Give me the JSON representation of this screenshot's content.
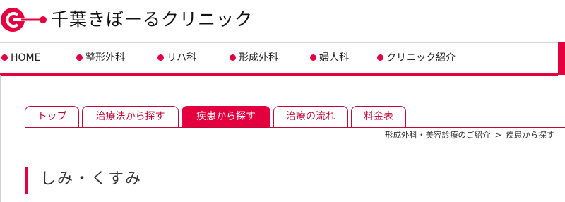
{
  "header": {
    "site_title": "千葉きぼーるクリニック",
    "brand_color": "#e4003f"
  },
  "gnav": {
    "items": [
      {
        "label": "HOME"
      },
      {
        "label": "整形外科"
      },
      {
        "label": "リハ科"
      },
      {
        "label": "形成外科"
      },
      {
        "label": "婦人科"
      },
      {
        "label": "クリニック紹介"
      }
    ]
  },
  "tabs": [
    {
      "label": "トップ",
      "active": false
    },
    {
      "label": "治療法から探す",
      "active": false
    },
    {
      "label": "疾患から探す",
      "active": true
    },
    {
      "label": "治療の流れ",
      "active": false
    },
    {
      "label": "料金表",
      "active": false
    }
  ],
  "breadcrumb": {
    "items": [
      "形成外科・美容診療のご紹介",
      "疾患から探す"
    ],
    "separator": ">"
  },
  "page": {
    "heading": "しみ・くすみ"
  }
}
